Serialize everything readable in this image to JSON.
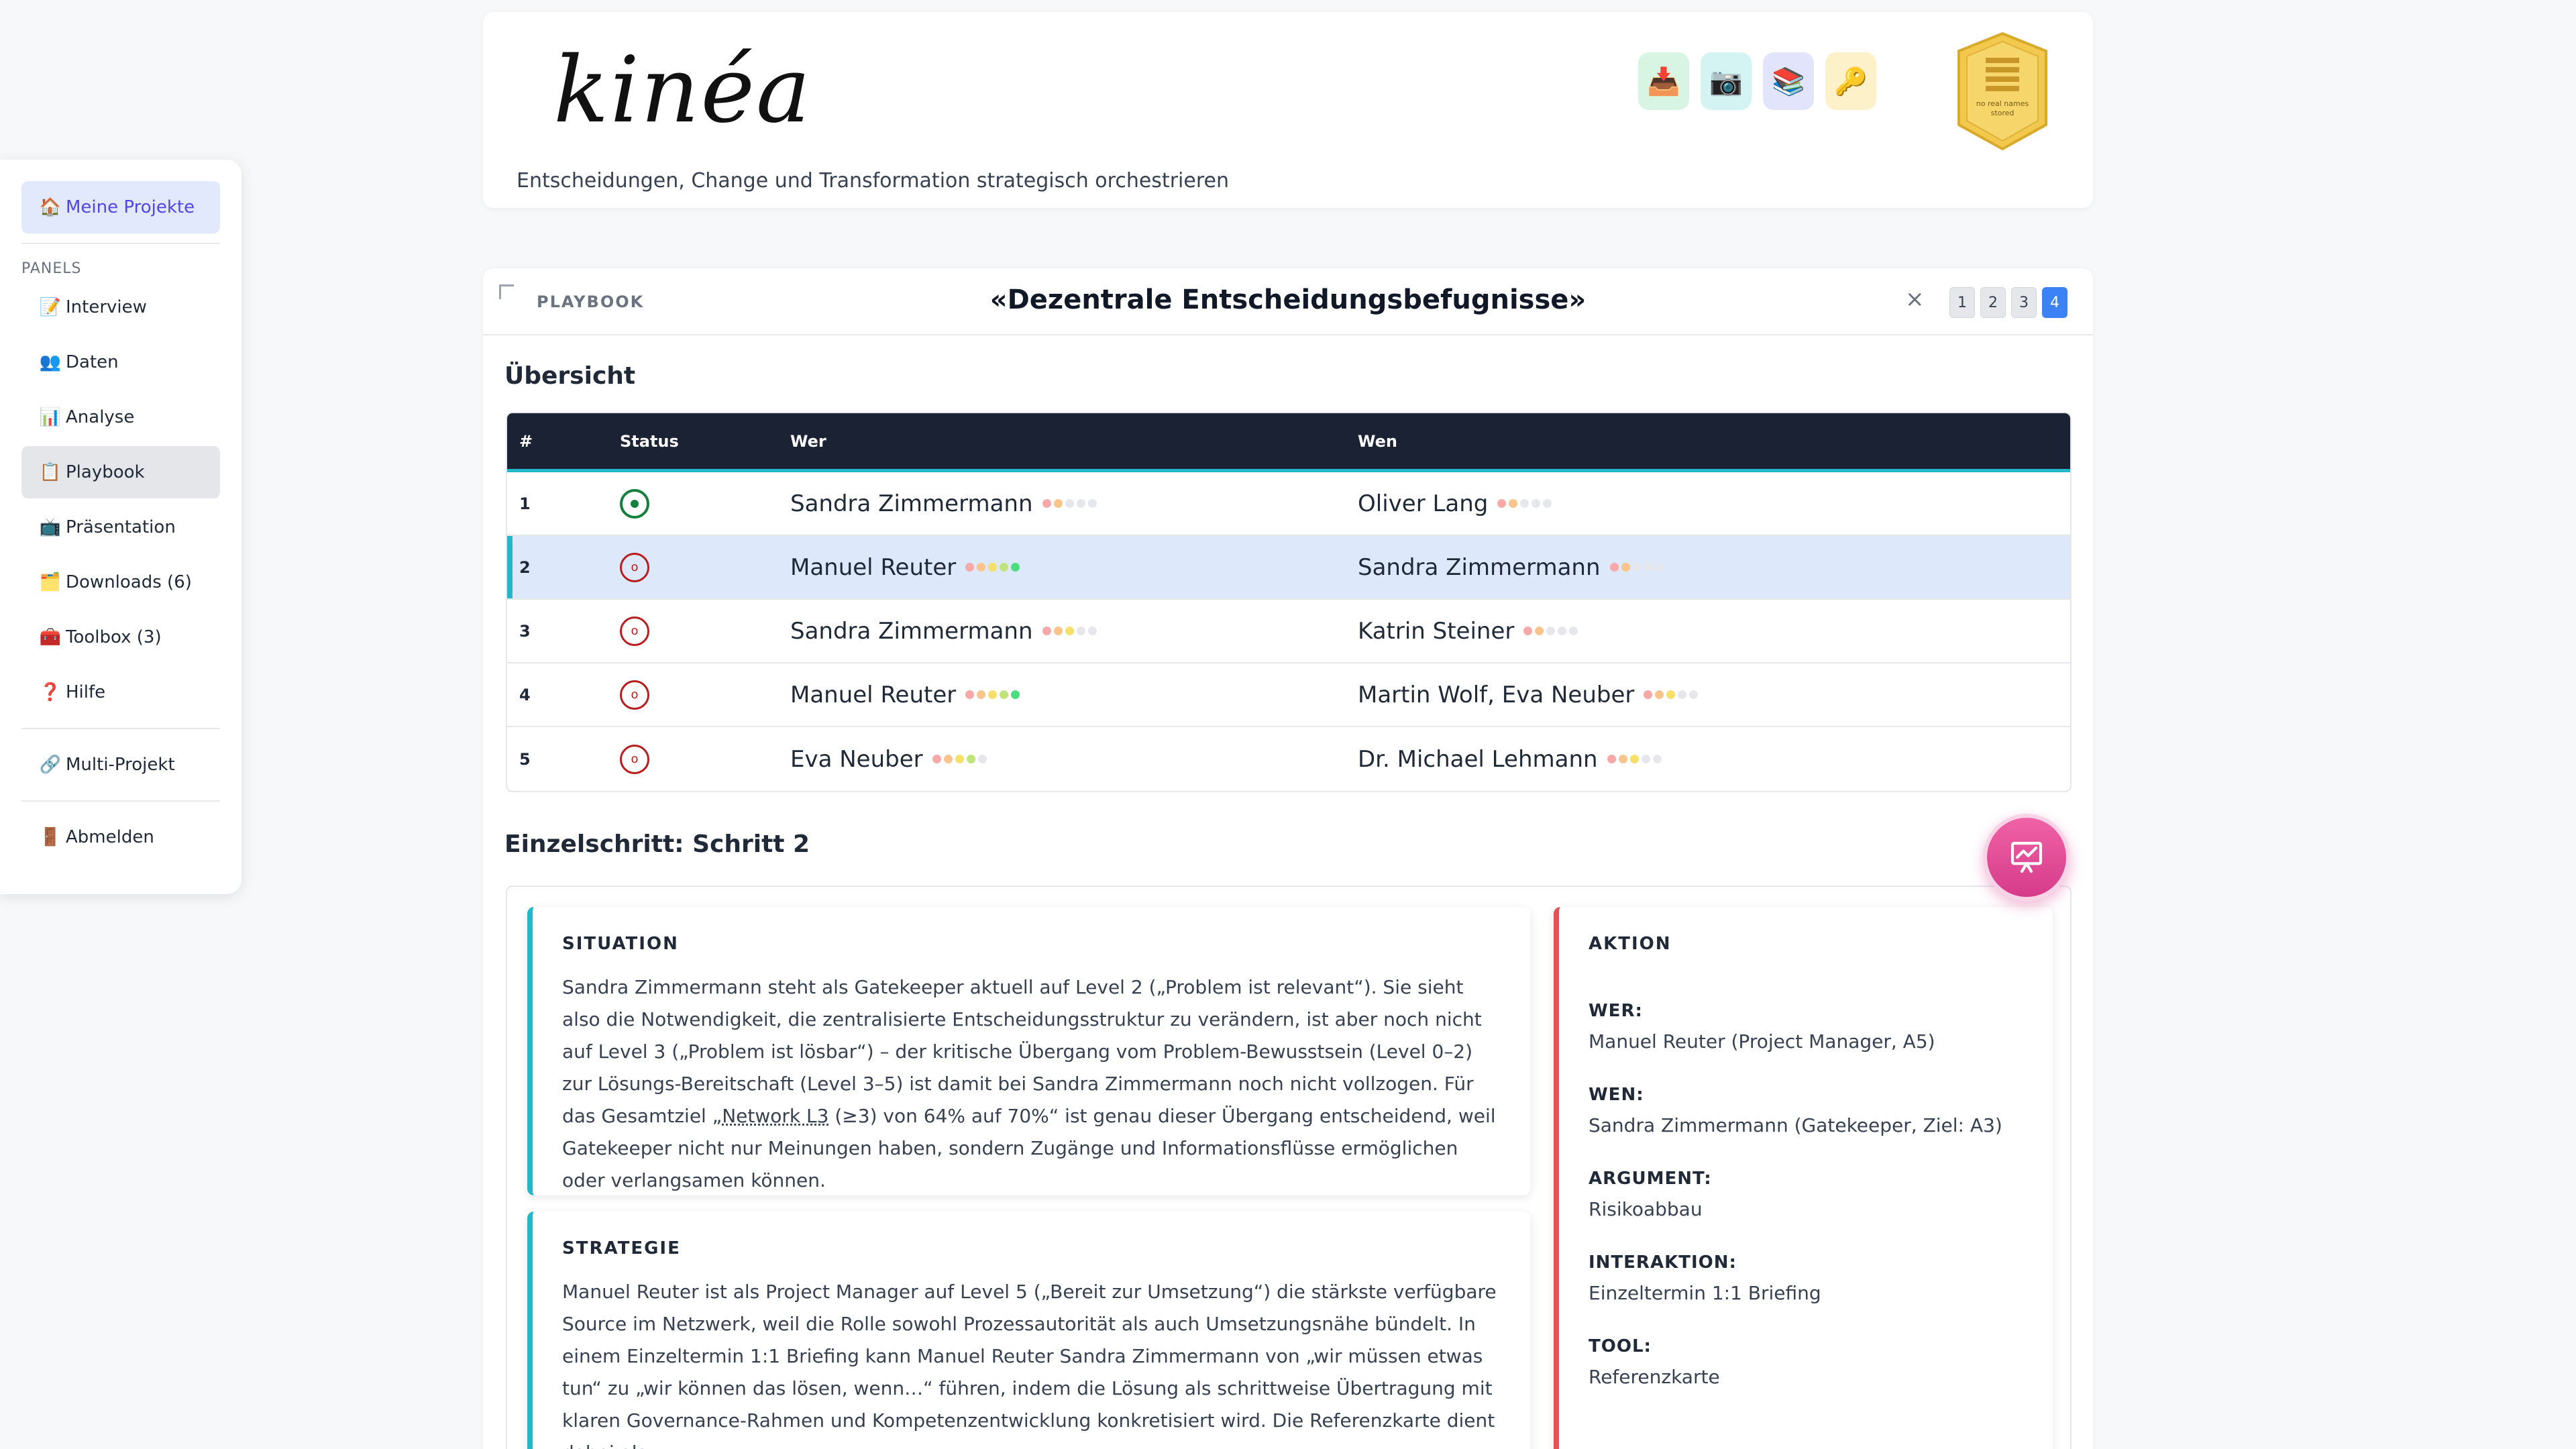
{
  "sidebar": {
    "projects": {
      "icon": "🏠",
      "label": "Meine Projekte"
    },
    "panels_heading": "PANELS",
    "items": [
      {
        "icon": "📝",
        "label": "Interview"
      },
      {
        "icon": "👥",
        "label": "Daten"
      },
      {
        "icon": "📊",
        "label": "Analyse"
      },
      {
        "icon": "📋",
        "label": "Playbook"
      },
      {
        "icon": "📺",
        "label": "Präsentation"
      },
      {
        "icon": "🗂️",
        "label": "Downloads (6)"
      },
      {
        "icon": "🧰",
        "label": "Toolbox (3)"
      },
      {
        "icon": "❓",
        "label": "Hilfe"
      }
    ],
    "multi": {
      "icon": "🔗",
      "label": "Multi-Projekt"
    },
    "logout": {
      "icon": "🚪",
      "label": "Abmelden"
    }
  },
  "header": {
    "logo": "kinéa",
    "subtitle": "Entscheidungen, Change und Transformation strategisch orchestrieren",
    "buttons": [
      {
        "icon": "📥",
        "name": "download-icon",
        "bg": "#d8f5e4"
      },
      {
        "icon": "📷",
        "name": "camera-icon",
        "bg": "#d4f3f3"
      },
      {
        "icon": "📚",
        "name": "books-icon",
        "bg": "#e1e4fb"
      },
      {
        "icon": "🔑",
        "name": "key-icon",
        "bg": "#fdf1c9"
      }
    ],
    "badge_text": [
      "no real names",
      "stored"
    ]
  },
  "playbook": {
    "label": "PLAYBOOK",
    "title": "«Dezentrale Entscheidungsbefugnisse»",
    "close": "×",
    "pages": [
      "1",
      "2",
      "3",
      "4"
    ],
    "active_page": "4"
  },
  "overview": {
    "title": "Übersicht",
    "columns": [
      "#",
      "Status",
      "Wer",
      "Wen"
    ],
    "rows": [
      {
        "num": "1",
        "status": "done",
        "wer": "Sandra Zimmermann",
        "wer_level": 2,
        "wen": "Oliver Lang",
        "wen_level": 2
      },
      {
        "num": "2",
        "status": "open",
        "wer": "Manuel Reuter",
        "wer_level": 5,
        "wen": "Sandra Zimmermann",
        "wen_level": 2
      },
      {
        "num": "3",
        "status": "open",
        "wer": "Sandra Zimmermann",
        "wer_level": 3,
        "wen": "Katrin Steiner",
        "wen_level": 2
      },
      {
        "num": "4",
        "status": "open",
        "wer": "Manuel Reuter",
        "wer_level": 5,
        "wen": "Martin Wolf, Eva Neuber",
        "wen_level": 3
      },
      {
        "num": "5",
        "status": "open",
        "wer": "Eva Neuber",
        "wer_level": 4,
        "wen": "Dr. Michael Lehmann",
        "wen_level": 3
      }
    ],
    "selected_row": 1,
    "level_colors": [
      "#f9a8a8",
      "#fbc48a",
      "#f7e06a",
      "#bfe57a",
      "#4ade80"
    ],
    "level_empty": "#e5e7eb"
  },
  "detail": {
    "title": "Einzelschritt: Schritt 2",
    "situation": {
      "title": "SITUATION",
      "text_before": "Sandra Zimmermann steht als Gatekeeper aktuell auf Level 2 („Problem ist relevant“). Sie sieht also die Notwendigkeit, die zentralisierte Entscheidungsstruktur zu verändern, ist aber noch nicht auf Level 3 („Problem ist lösbar“) – der kritische Übergang vom Problem-Bewusstsein (Level 0–2) zur Lösungs-Bereitschaft (Level 3–5) ist damit bei Sandra Zimmermann noch nicht vollzogen. Für das Gesamtziel „",
      "link": "Network L3",
      "text_after": " (≥3) von 64% auf 70%“ ist genau dieser Übergang entscheidend, weil Gatekeeper nicht nur Meinungen haben, sondern Zugänge und Informationsflüsse ermöglichen oder verlangsamen können."
    },
    "strategie": {
      "title": "STRATEGIE",
      "text": "Manuel Reuter ist als Project Manager auf Level 5 („Bereit zur Umsetzung“) die stärkste verfügbare Source im Netzwerk, weil die Rolle sowohl Prozessautorität als auch Umsetzungsnähe bündelt. In einem Einzeltermin 1:1 Briefing kann Manuel Reuter Sandra Zimmermann von „wir müssen etwas tun“ zu „wir können das lösen, wenn…“ führen, indem die Lösung als schrittweise Übertragung mit klaren Governance-Rahmen und Kompetenzentwicklung konkretisiert wird. Die Referenzkarte dient dabei als"
    },
    "aktion": {
      "title": "AKTION",
      "fields": [
        {
          "label": "WER:",
          "value": "Manuel Reuter (Project Manager, A5)"
        },
        {
          "label": "WEN:",
          "value": "Sandra Zimmermann (Gatekeeper, Ziel: A3)"
        },
        {
          "label": "ARGUMENT:",
          "value": "Risikoabbau"
        },
        {
          "label": "INTERAKTION:",
          "value": "Einzeltermin 1:1 Briefing"
        },
        {
          "label": "TOOL:",
          "value": "Referenzkarte"
        }
      ]
    }
  }
}
